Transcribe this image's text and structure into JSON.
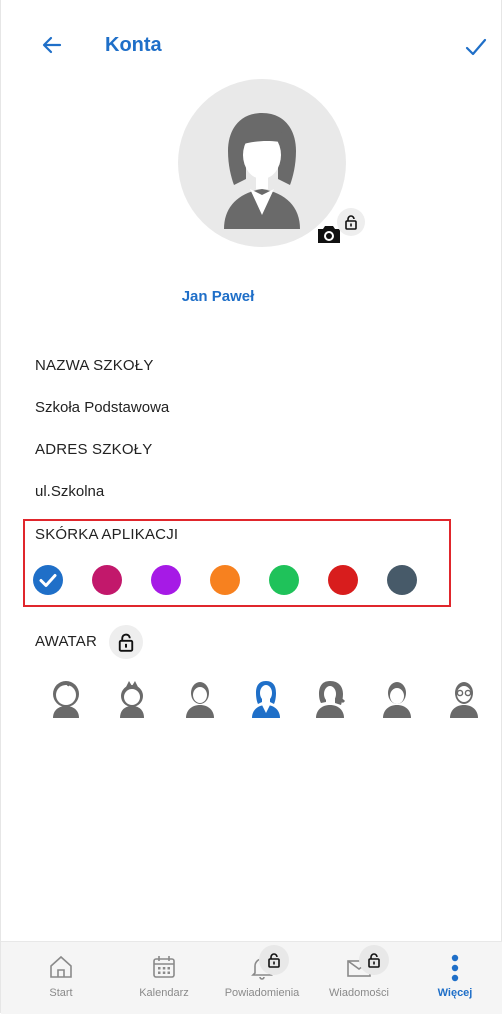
{
  "header": {
    "title": "Konta"
  },
  "profile": {
    "name": "Jan Paweł"
  },
  "fields": [
    {
      "label": "NAZWA SZKOŁY",
      "value": "Szkoła Podstawowa"
    },
    {
      "label": "ADRES SZKOŁY",
      "value": "ul.Szkolna"
    }
  ],
  "skin": {
    "label": "SKÓRKA APLIKACJI",
    "selected_index": 0,
    "colors": [
      "#1f6fc8",
      "#c2186b",
      "#a61ae6",
      "#f7811f",
      "#1fc25a",
      "#d81d1d",
      "#475a69"
    ]
  },
  "avatar_section": {
    "label": "AWATAR",
    "selected_index": 3,
    "icons": [
      "baby-icon",
      "child-icon",
      "boy-icon",
      "woman-icon",
      "girl-icon",
      "man-icon",
      "old-man-icon"
    ]
  },
  "nav": {
    "items": [
      {
        "label": "Start",
        "icon": "home-icon",
        "locked": false
      },
      {
        "label": "Kalendarz",
        "icon": "calendar-icon",
        "locked": false
      },
      {
        "label": "Powiadomienia",
        "icon": "bell-icon",
        "locked": true
      },
      {
        "label": "Wiadomości",
        "icon": "mail-icon",
        "locked": true
      },
      {
        "label": "Więcej",
        "icon": "more-icon",
        "locked": false,
        "active": true
      }
    ]
  },
  "colors": {
    "accent": "#1f6fc8",
    "highlight_border": "#e0262c",
    "avatar_gray": "#6a6a6a"
  }
}
